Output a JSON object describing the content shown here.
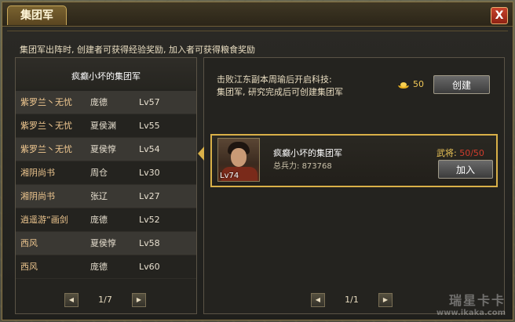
{
  "window": {
    "title": "集团军",
    "close_label": "X"
  },
  "notice": "集团军出阵时, 创建者可获得经验奖励, 加入者可获得粮食奖励",
  "left_panel": {
    "header": "疯癫小坏的集团军",
    "rows": [
      {
        "name": "紫罗兰丶无忧",
        "general": "庞德",
        "level": "Lv57"
      },
      {
        "name": "紫罗兰丶无忧",
        "general": "夏侯渊",
        "level": "Lv55"
      },
      {
        "name": "紫罗兰丶无忧",
        "general": "夏侯惇",
        "level": "Lv54"
      },
      {
        "name": "湘阴尚书",
        "general": "周仓",
        "level": "Lv30"
      },
      {
        "name": "湘阴尚书",
        "general": "张辽",
        "level": "Lv27"
      },
      {
        "name": "逍遥游“画剑",
        "general": "庞德",
        "level": "Lv52"
      },
      {
        "name": "西风",
        "general": "夏侯惇",
        "level": "Lv58"
      },
      {
        "name": "西风",
        "general": "庞德",
        "level": "Lv60"
      }
    ],
    "page": "1/7"
  },
  "right_panel": {
    "tip_line1": "击败江东副本周瑜后开启科技:",
    "tip_line2": "集团军, 研究完成后可创建集团军",
    "cost": "50",
    "create_label": "创建",
    "card": {
      "leader_level": "Lv74",
      "name": "疯癫小坏的集团军",
      "troops_label": "总兵力:",
      "troops_value": "873768",
      "generals_label": "武将:",
      "generals_value": "50/50",
      "join_label": "加入"
    },
    "page": "1/1"
  },
  "watermark": {
    "line1": "瑞星卡卡",
    "line2": "www.ikaka.com"
  }
}
